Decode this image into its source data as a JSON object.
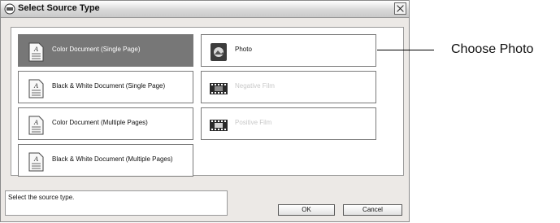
{
  "window": {
    "title": "Select Source Type"
  },
  "tiles": [
    {
      "label": "Color Document (Single Page)",
      "icon": "document-icon",
      "state": "selected"
    },
    {
      "label": "Photo",
      "icon": "photo-icon",
      "state": "normal"
    },
    {
      "label": "Black & White Document (Single Page)",
      "icon": "document-icon",
      "state": "normal"
    },
    {
      "label": "Negative Film",
      "icon": "film-icon",
      "state": "disabled"
    },
    {
      "label": "Color Document (Multiple Pages)",
      "icon": "document-icon",
      "state": "normal"
    },
    {
      "label": "Positive Film",
      "icon": "film-icon",
      "state": "disabled"
    },
    {
      "label": "Black & White Document (Multiple Pages)",
      "icon": "document-icon",
      "state": "normal"
    }
  ],
  "status": {
    "text": "Select the source type."
  },
  "buttons": {
    "ok": "OK",
    "cancel": "Cancel"
  },
  "callout": {
    "text": "Choose Photo"
  },
  "colors": {
    "selected": "#777777",
    "disabled_text": "#c8c8c8",
    "dialog_bg": "#ece9e6"
  }
}
